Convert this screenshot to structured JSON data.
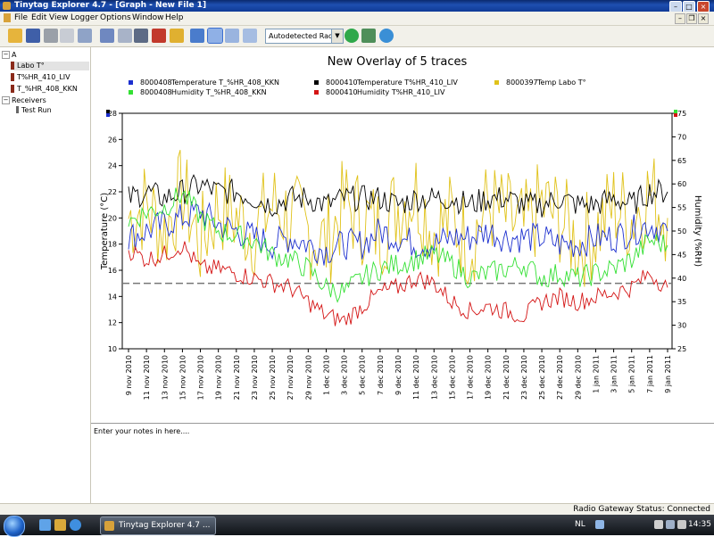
{
  "window": {
    "title": "Tinytag Explorer 4.7 - [Graph - New File 1]"
  },
  "menu": [
    "File",
    "Edit",
    "View",
    "Logger",
    "Options",
    "Window",
    "Help"
  ],
  "toolbar": {
    "icons": [
      "open-folder-icon",
      "save-icon",
      "print-icon",
      "copy-icon",
      "paste-icon",
      "graph-icon",
      "table-icon",
      "summary-icon",
      "stop-logger-icon",
      "overlay-icon",
      "pan-icon",
      "zoom-in-icon",
      "zoom-out-icon",
      "zoom-fit-icon",
      "refresh-icon",
      "launch-icon",
      "gateway-icon"
    ],
    "radio_select": "Autodetected Radio"
  },
  "tree": {
    "root": "A",
    "items": [
      "Labo T°",
      "T%HR_410_LIV",
      "T_%HR_408_KKN"
    ],
    "receivers_label": "Receivers",
    "receivers": [
      "Test Run"
    ]
  },
  "notes": {
    "placeholder": "Enter your notes in here...."
  },
  "status": {
    "text": "Radio Gateway Status: Connected"
  },
  "taskbar": {
    "item": "Tinytag Explorer 4.7 ...",
    "lang": "NL",
    "time": "14:35"
  },
  "colors": {
    "blue": "#1c2fcf",
    "green": "#33e033",
    "black": "#000000",
    "red": "#d41414",
    "yellow": "#e0c21a"
  },
  "chart_data": {
    "type": "line",
    "title": "New Overlay of 5 traces",
    "ylabel": "Temperature (°C)",
    "y2label": "Humidity (%RH)",
    "ylim": [
      10,
      28
    ],
    "y2lim": [
      25,
      75
    ],
    "yticks": [
      10,
      12,
      14,
      16,
      18,
      20,
      22,
      24,
      26,
      28
    ],
    "y2ticks": [
      25,
      30,
      35,
      40,
      45,
      50,
      55,
      60,
      65,
      70,
      75
    ],
    "x_tick_labels": [
      "9 nov 2010",
      "11 nov 2010",
      "13 nov 2010",
      "15 nov 2010",
      "17 nov 2010",
      "19 nov 2010",
      "21 nov 2010",
      "23 nov 2010",
      "25 nov 2010",
      "27 nov 2010",
      "29 nov 2010",
      "1 dec 2010",
      "3 dec 2010",
      "5 dec 2010",
      "7 dec 2010",
      "9 dec 2010",
      "11 dec 2010",
      "13 dec 2010",
      "15 dec 2010",
      "17 dec 2010",
      "19 dec 2010",
      "21 dec 2010",
      "23 dec 2010",
      "25 dec 2010",
      "27 dec 2010",
      "29 dec 2010",
      "1 jan 2011",
      "3 jan 2011",
      "5 jan 2011",
      "7 jan 2011",
      "9 jan 2011"
    ],
    "reference_line": 15,
    "legend": [
      {
        "id": "8000408",
        "label": "Temperature T_%HR_408_KKN",
        "color": "#1c2fcf"
      },
      {
        "id": "8000410",
        "label": "Temperature T%HR_410_LIV",
        "color": "#000000"
      },
      {
        "id": "8000397",
        "label": "Temp Labo T°",
        "color": "#e0c21a"
      },
      {
        "id": "8000408",
        "label": "Humidity T_%HR_408_KKN",
        "color": "#33e033"
      },
      {
        "id": "8000410",
        "label": "Humidity T%HR_410_LIV",
        "color": "#d41414"
      }
    ],
    "series": [
      {
        "name": "Temperature T_%HR_408_KKN",
        "axis": "left",
        "color": "#1c2fcf",
        "values": [
          18.5,
          19.0,
          19.5,
          20.0,
          20.5,
          19.5,
          19.0,
          18.5,
          18.0,
          18.5,
          18.0,
          17.5,
          18.0,
          18.0,
          19.0,
          18.5,
          18.0,
          18.0,
          18.5,
          18.5,
          19.0,
          18.5,
          18.5,
          18.5,
          18.0,
          18.0,
          18.5,
          18.5,
          19.0,
          19.5,
          19.0
        ]
      },
      {
        "name": "Temperature T%HR_410_LIV",
        "axis": "left",
        "color": "#000000",
        "values": [
          21.5,
          22.0,
          21.5,
          22.0,
          22.5,
          22.0,
          22.0,
          21.5,
          21.0,
          21.5,
          21.5,
          21.0,
          21.5,
          21.5,
          21.5,
          21.0,
          21.5,
          21.5,
          21.5,
          21.0,
          21.5,
          21.5,
          21.0,
          21.0,
          21.5,
          21.0,
          21.0,
          21.5,
          21.0,
          22.0,
          22.0
        ]
      },
      {
        "name": "Temp Labo T°",
        "axis": "left",
        "color": "#e0c21a",
        "values": [
          20,
          21,
          19,
          22,
          18,
          21,
          20,
          19,
          21,
          20,
          19,
          18,
          21,
          20,
          19,
          21,
          22,
          19,
          20,
          18,
          21,
          20,
          19,
          21,
          20,
          18,
          19,
          21,
          20,
          22,
          20
        ]
      },
      {
        "name": "Humidity T_%HR_408_KKN",
        "axis": "right",
        "color": "#33e033",
        "values": [
          52,
          54,
          55,
          58,
          53,
          50,
          49,
          48,
          45,
          44,
          42,
          38,
          37,
          40,
          42,
          43,
          44,
          45,
          43,
          40,
          41,
          42,
          43,
          40,
          41,
          40,
          41,
          42,
          44,
          48,
          47
        ]
      },
      {
        "name": "Humidity T%HR_410_LIV",
        "axis": "right",
        "color": "#d41414",
        "values": [
          46,
          44,
          45,
          47,
          42,
          42,
          41,
          40,
          39,
          38,
          35,
          32,
          31,
          34,
          37,
          38,
          40,
          39,
          35,
          33,
          34,
          33,
          32,
          35,
          36,
          35,
          36,
          37,
          38,
          41,
          38
        ]
      }
    ]
  }
}
